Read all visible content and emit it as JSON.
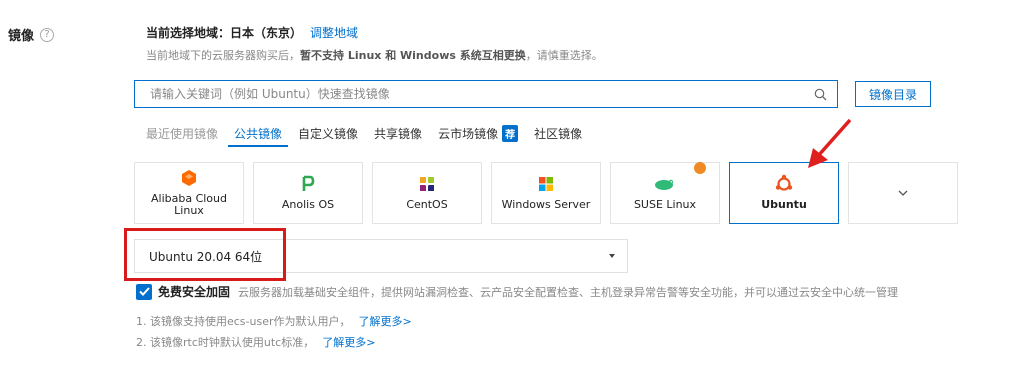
{
  "section": {
    "label": "镜像",
    "help_icon": "?"
  },
  "region": {
    "current_label": "当前选择地域：日本（东京）",
    "adjust_link": "调整地域",
    "note_prefix": "当前地域下的云服务器购买后，",
    "note_bold": "暂不支持 Linux 和 Windows 系统互相更换",
    "note_suffix": "，请慎重选择。"
  },
  "search": {
    "placeholder": "请输入关键词（例如 Ubuntu）快速查找镜像",
    "value": ""
  },
  "catalog_button": "镜像目录",
  "tabs": [
    {
      "label": "最近使用镜像",
      "state": "muted"
    },
    {
      "label": "公共镜像",
      "state": "active"
    },
    {
      "label": "自定义镜像",
      "state": "normal"
    },
    {
      "label": "共享镜像",
      "state": "normal"
    },
    {
      "label": "云市场镜像",
      "state": "normal",
      "badge": "荐"
    },
    {
      "label": "社区镜像",
      "state": "normal"
    }
  ],
  "os_cards": [
    {
      "label": "Alibaba Cloud Linux",
      "icon": "alibaba-cloud-icon",
      "color": "#ff6a00"
    },
    {
      "label": "Anolis OS",
      "icon": "anolis-icon",
      "color": "#2fa84f"
    },
    {
      "label": "CentOS",
      "icon": "centos-icon",
      "color": "#9b3a8f"
    },
    {
      "label": "Windows Server",
      "icon": "windows-icon",
      "color": "#0078d4"
    },
    {
      "label": "SUSE Linux",
      "icon": "suse-icon",
      "color": "#30ba78"
    },
    {
      "label": "Ubuntu",
      "icon": "ubuntu-icon",
      "color": "#e95420",
      "selected": true
    },
    {
      "label": "",
      "icon": "chevron-down-icon"
    }
  ],
  "version_select": {
    "value": "Ubuntu 20.04 64位"
  },
  "security": {
    "checked": true,
    "label": "免费安全加固",
    "description": "云服务器加载基础安全组件，提供网站漏洞检查、云产品安全配置检查、主机登录异常告警等安全功能，并可以通过云安全中心统一管理"
  },
  "notes": [
    {
      "text": "1. 该镜像支持使用ecs-user作为默认用户，",
      "link": "了解更多>"
    },
    {
      "text": "2. 该镜像rtc时钟默认使用utc标准，",
      "link": "了解更多>"
    }
  ],
  "colors": {
    "accent": "#0070cc",
    "annotation": "#d91a1a"
  }
}
